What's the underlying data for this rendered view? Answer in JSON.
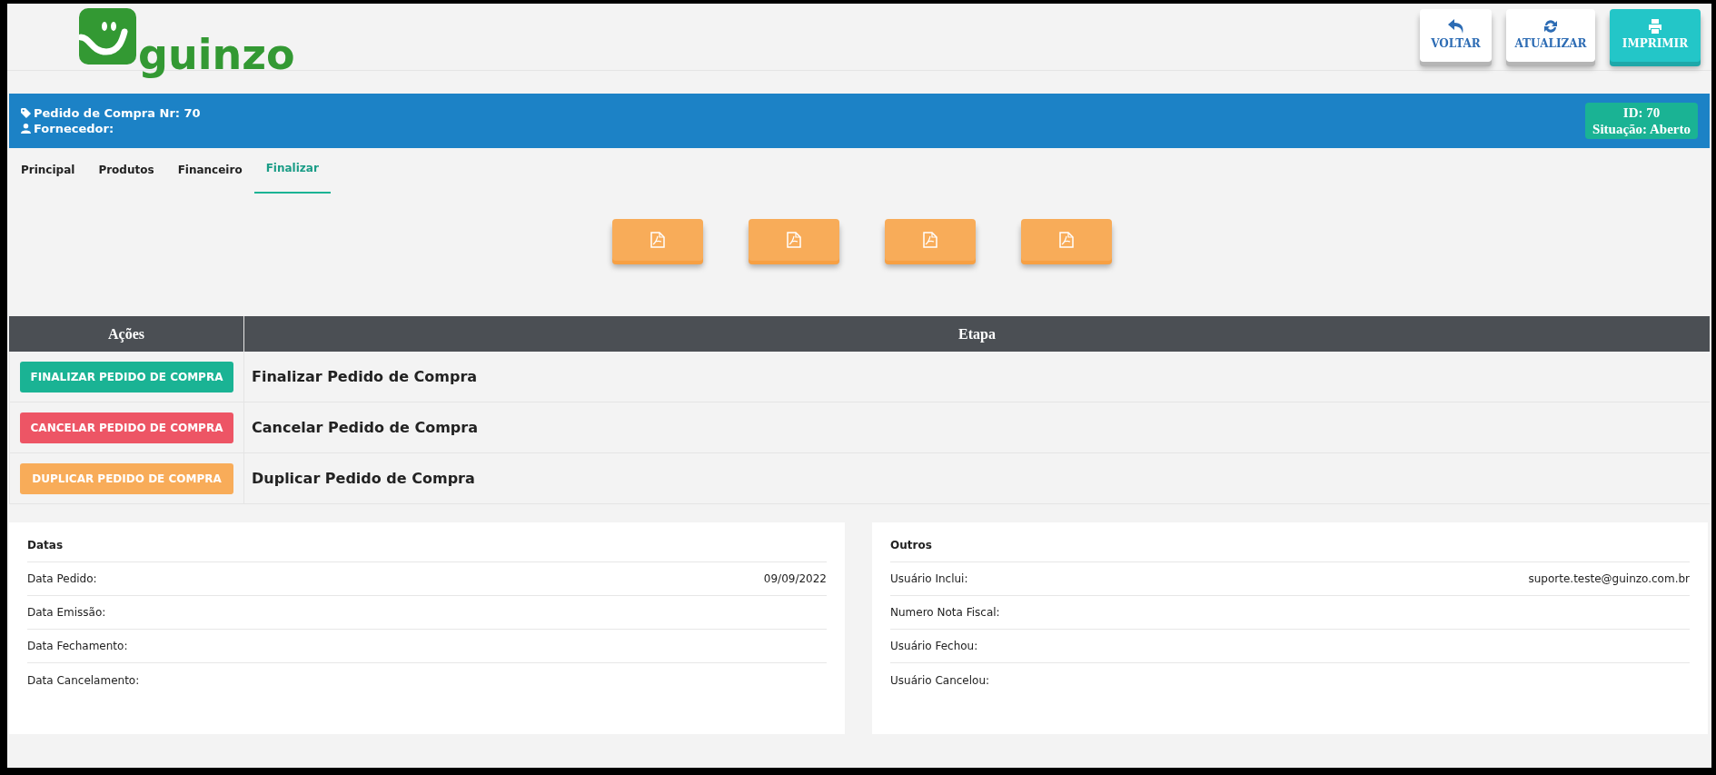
{
  "logo": {
    "text": "guinzo"
  },
  "toolbar": [
    {
      "label": "VOLTAR",
      "kind": "back"
    },
    {
      "label": "ATUALIZAR",
      "kind": "refresh"
    },
    {
      "label": "IMPRIMIR",
      "kind": "print"
    }
  ],
  "order_header": {
    "title": "Pedido de Compra Nr: 70",
    "supplier": "Fornecedor:",
    "id": "ID: 70",
    "status": "Situação: Aberto"
  },
  "tabs": [
    {
      "label": "Principal",
      "selected": false
    },
    {
      "label": "Produtos",
      "selected": false
    },
    {
      "label": "Financeiro",
      "selected": false
    },
    {
      "label": "Finalizar",
      "selected": true
    }
  ],
  "pdf_buttons": [
    {
      "kind": "pdf"
    },
    {
      "kind": "pdf"
    },
    {
      "kind": "pdf"
    },
    {
      "kind": "pdf"
    }
  ],
  "actions_table": {
    "columns": [
      "Ações",
      "Etapa"
    ],
    "rows": [
      {
        "action": "FINALIZAR PEDIDO DE COMPRA",
        "color": "#1ab394",
        "step": "Finalizar Pedido de Compra"
      },
      {
        "action": "CANCELAR PEDIDO DE COMPRA",
        "color": "#ed5565",
        "step": "Cancelar Pedido de Compra"
      },
      {
        "action": "DUPLICAR PEDIDO DE COMPRA",
        "color": "#f8ac59",
        "step": "Duplicar Pedido de Compra"
      }
    ]
  },
  "panels": [
    {
      "title": "Datas",
      "rows": [
        {
          "label": "Data Pedido:",
          "value": "09/09/2022"
        },
        {
          "label": "Data Emissão:"
        },
        {
          "label": "Data Fechamento:"
        },
        {
          "label": "Data Cancelamento:"
        }
      ]
    },
    {
      "title": "Outros",
      "rows": [
        {
          "label": "Usuário Inclui:",
          "value": "suporte.teste@guinzo.com.br"
        },
        {
          "label": "Numero Nota Fiscal:"
        },
        {
          "label": "Usuário Fechou:"
        },
        {
          "label": "Usuário Cancelou:"
        }
      ]
    }
  ]
}
